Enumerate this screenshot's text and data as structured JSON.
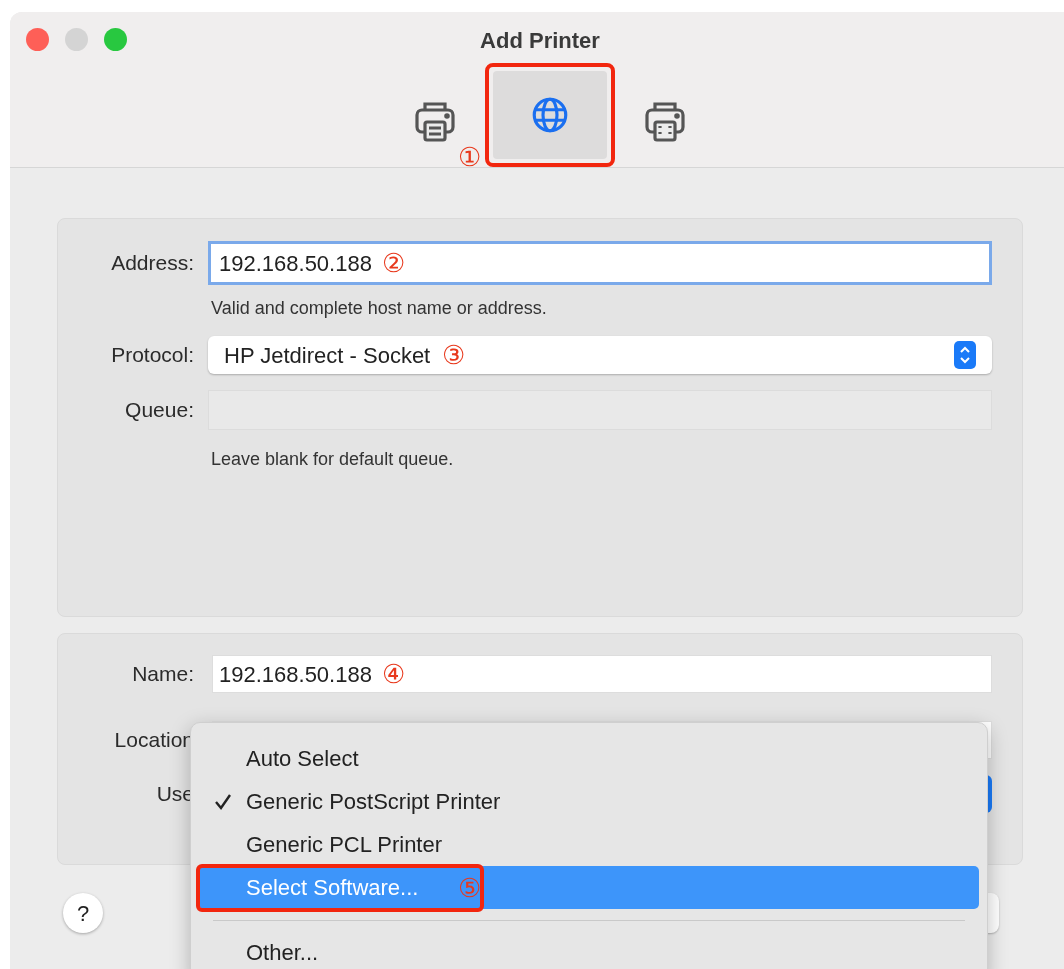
{
  "window": {
    "title": "Add Printer"
  },
  "toolbar": [
    {
      "kind": "printer",
      "selected": false,
      "marker": "①"
    },
    {
      "kind": "globe",
      "selected": true
    },
    {
      "kind": "fax",
      "selected": false
    }
  ],
  "address": {
    "label": "Address:",
    "value": "192.168.50.188",
    "marker": "②",
    "hint": "Valid and complete host name or address."
  },
  "protocol": {
    "label": "Protocol:",
    "value": "HP Jetdirect - Socket",
    "marker": "③"
  },
  "queue": {
    "label": "Queue:",
    "disabled": true,
    "hint": "Leave blank for default queue."
  },
  "name": {
    "label": "Name:",
    "value": "192.168.50.188",
    "marker": "④"
  },
  "location": {
    "label": "Location"
  },
  "use": {
    "label": "Use"
  },
  "help": {
    "label": "?"
  },
  "menu": [
    {
      "kind": "item",
      "label": "Auto Select",
      "checked": false,
      "selected": false
    },
    {
      "kind": "item",
      "label": "Generic PostScript Printer",
      "checked": true,
      "selected": false
    },
    {
      "kind": "item",
      "label": "Generic PCL Printer",
      "checked": false,
      "selected": false
    },
    {
      "kind": "item",
      "label": "Select Software...",
      "checked": false,
      "selected": true,
      "marker": "⑤"
    },
    {
      "kind": "separator"
    },
    {
      "kind": "item",
      "label": "Other...",
      "checked": false,
      "selected": false
    }
  ]
}
